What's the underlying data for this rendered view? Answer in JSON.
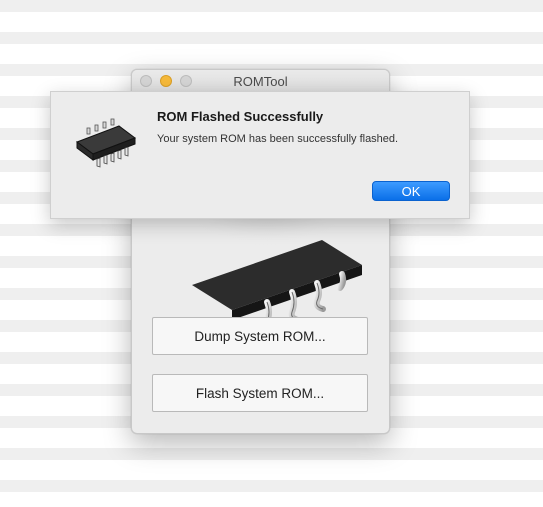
{
  "window": {
    "title": "ROMTool",
    "dump_button": "Dump System ROM...",
    "flash_button": "Flash System ROM..."
  },
  "alert": {
    "title": "ROM Flashed Successfully",
    "message": "Your system ROM has been successfully flashed.",
    "ok_label": "OK",
    "icon": "rom-chip-icon"
  },
  "colors": {
    "accent": "#0a6fe8",
    "traffic_minimize": "#f5b93a"
  }
}
